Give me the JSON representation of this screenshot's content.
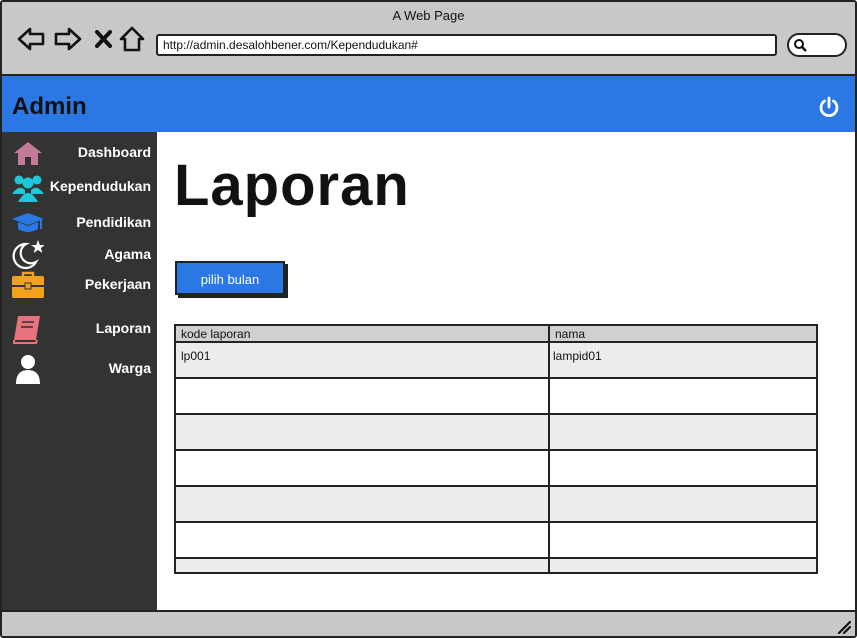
{
  "browser": {
    "window_title": "A Web Page",
    "url": "http://admin.desalohbener.com/Kependudukan#"
  },
  "header": {
    "brand": "Admin"
  },
  "sidebar": {
    "items": [
      {
        "label": "Dashboard",
        "icon": "home-icon",
        "color": "#c37a9a"
      },
      {
        "label": "Kependudukan",
        "icon": "users-icon",
        "color": "#1ec8d8"
      },
      {
        "label": "Pendidikan",
        "icon": "graduation-cap-icon",
        "color": "#2b78e4"
      },
      {
        "label": "Agama",
        "icon": "moon-star-icon",
        "color": "#ffffff"
      },
      {
        "label": "Pekerjaan",
        "icon": "briefcase-icon",
        "color": "#f2a21b"
      },
      {
        "label": "Laporan",
        "icon": "book-icon",
        "color": "#e8737c"
      },
      {
        "label": "Warga",
        "icon": "user-icon",
        "color": "#ffffff"
      }
    ]
  },
  "main": {
    "title": "Laporan",
    "pick_button": "pilih bulan",
    "table": {
      "columns": [
        "kode laporan",
        "nama"
      ],
      "rows": [
        [
          "lp001",
          "lampid01"
        ],
        [
          "",
          ""
        ],
        [
          "",
          ""
        ],
        [
          "",
          ""
        ],
        [
          "",
          ""
        ],
        [
          "",
          ""
        ],
        [
          "",
          ""
        ]
      ]
    }
  },
  "colors": {
    "accent": "#2b78e4",
    "sidebar_bg": "#333333",
    "chrome_bg": "#c8c8c8"
  }
}
